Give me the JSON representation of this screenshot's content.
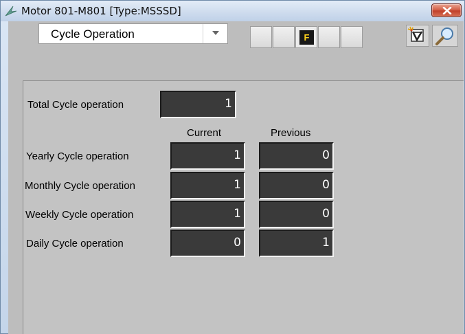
{
  "window": {
    "title": "Motor 801-M801  [Type:MSSSD]"
  },
  "toolbar": {
    "mode_select": {
      "value": "Cycle Operation"
    },
    "status_flags": [
      {
        "label": "",
        "active": false
      },
      {
        "label": "",
        "active": false
      },
      {
        "label": "F",
        "active": true,
        "color": "#ffd21a"
      },
      {
        "label": "",
        "active": false
      },
      {
        "label": "",
        "active": false
      }
    ],
    "icons": [
      "trend-icon",
      "search-icon"
    ]
  },
  "panel": {
    "total": {
      "label": "Total Cycle operation",
      "value": "1"
    },
    "columns": {
      "current": "Current",
      "previous": "Previous"
    },
    "rows": [
      {
        "label": "Yearly Cycle operation",
        "current": "1",
        "previous": "0"
      },
      {
        "label": "Monthly Cycle operation",
        "current": "1",
        "previous": "0"
      },
      {
        "label": "Weekly Cycle operation",
        "current": "1",
        "previous": "0"
      },
      {
        "label": "Daily Cycle operation",
        "current": "0",
        "previous": "1"
      }
    ]
  }
}
